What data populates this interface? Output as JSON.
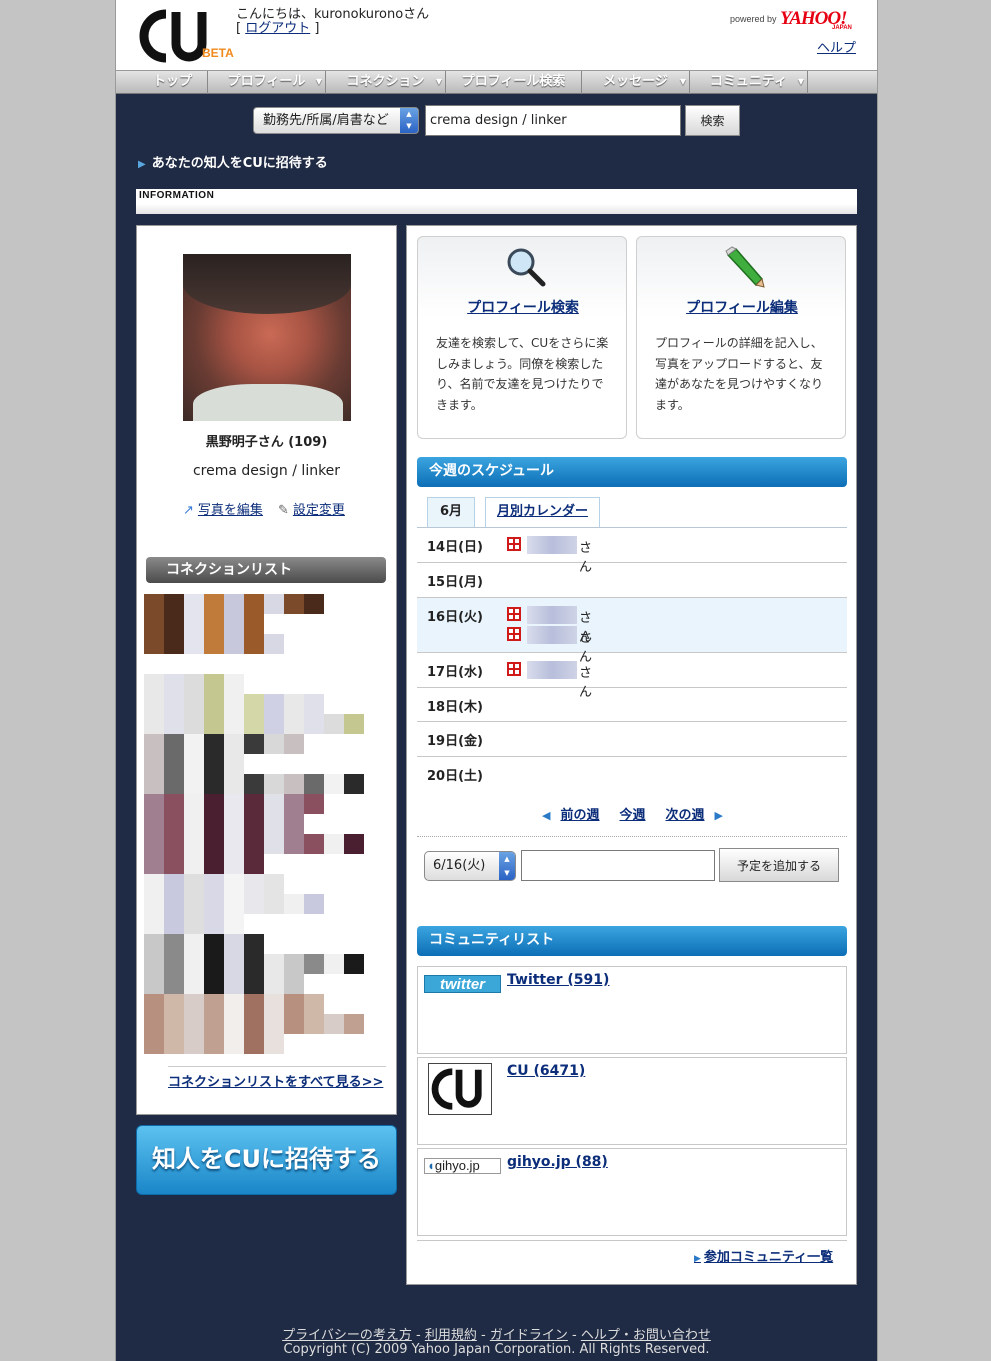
{
  "header": {
    "greeting": "こんにちは、kuronokuronoさん",
    "logout_prefix": "[ ",
    "logout_label": "ログアウト",
    "logout_suffix": " ]",
    "logo_beta": "BETA",
    "powered_by": "powered by",
    "yahoo": "YAHOO!",
    "yahoo_japan": "JAPAN",
    "help_label": "ヘルプ"
  },
  "nav": {
    "items": [
      {
        "label": "トップ",
        "dropdown": false
      },
      {
        "label": "プロフィール",
        "dropdown": true
      },
      {
        "label": "コネクション",
        "dropdown": true
      },
      {
        "label": "プロフィール検索",
        "dropdown": false
      },
      {
        "label": "メッセージ",
        "dropdown": true
      },
      {
        "label": "コミュニティ",
        "dropdown": true
      }
    ]
  },
  "search": {
    "select_value": "勤務先/所属/肩書など",
    "input_value": "crema design / linker",
    "button_label": "検索"
  },
  "invite_link": "あなたの知人をCUに招待する",
  "information_label": "INFORMATION",
  "profile": {
    "name": "黒野明子さん (109)",
    "company": "crema design / linker",
    "edit_photo_label": "写真を編集",
    "settings_label": "設定変更"
  },
  "connections": {
    "header": "コネクションリスト",
    "view_all_label": "コネクションリストをすべて見る>>"
  },
  "invite_button_label": "知人をCUに招待する",
  "features": [
    {
      "title": "プロフィール検索",
      "description": "友達を検索して、CUをさらに楽しみましょう。同僚を検索したり、名前で友達を見つけたりできます。",
      "icon": "magnifier-icon"
    },
    {
      "title": "プロフィール編集",
      "description": "プロフィールの詳細を記入し、写真をアップロードすると、友達があなたを見つけやすくなります。",
      "icon": "pencil-icon"
    }
  ],
  "schedule": {
    "header": "今週のスケジュール",
    "month_tab": "6月",
    "calendar_tab": "月別カレンダー",
    "days": [
      {
        "label": "14日(日)",
        "events": [
          "さん"
        ]
      },
      {
        "label": "15日(月)",
        "events": []
      },
      {
        "label": "16日(火)",
        "events": [
          "さん",
          "さん"
        ],
        "highlight": true
      },
      {
        "label": "17日(水)",
        "events": [
          "さん"
        ]
      },
      {
        "label": "18日(木)",
        "events": []
      },
      {
        "label": "19日(金)",
        "events": []
      },
      {
        "label": "20日(土)",
        "events": []
      }
    ],
    "prev_week": "前の週",
    "this_week": "今週",
    "next_week": "次の週",
    "date_select_value": "6/16(火)",
    "event_input_value": "",
    "add_button_label": "予定を追加する"
  },
  "communities": {
    "header": "コミュニティリスト",
    "items": [
      {
        "name": "Twitter (591)",
        "logo_text": "twitter"
      },
      {
        "name": "CU (6471)",
        "logo_text": ""
      },
      {
        "name": "gihyo.jp (88)",
        "logo_text": "gihyo.jp"
      }
    ],
    "view_all_label": "参加コミュニティ一覧"
  },
  "footer": {
    "privacy": "プライバシーの考え方",
    "terms": "利用規約",
    "guideline": "ガイドライン",
    "help_contact": "ヘルプ・お問い合わせ",
    "separator": " - ",
    "copyright": "Copyright (C) 2009 Yahoo Japan Corporation. All Rights Reserved."
  },
  "colors": {
    "page_bg": "#1f2a44",
    "accent_blue": "#0d6eb6",
    "link": "#0b2d7a",
    "yahoo_red": "#e60012",
    "beta_orange": "#f08a1c"
  }
}
